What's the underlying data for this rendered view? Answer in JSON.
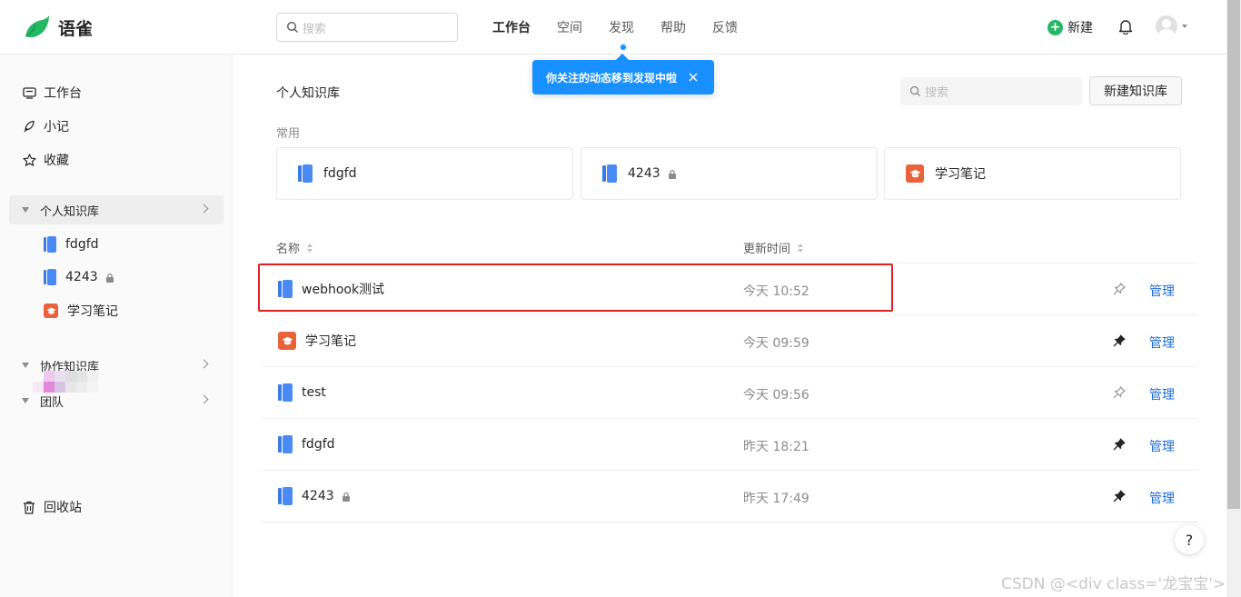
{
  "app": {
    "name": "语雀"
  },
  "header": {
    "search_placeholder": "搜索",
    "nav": [
      "工作台",
      "空间",
      "发现",
      "帮助",
      "反馈"
    ],
    "new_label": "新建"
  },
  "tooltip": {
    "text": "你关注的动态移到发现中啦"
  },
  "sidebar": {
    "workbench": "工作台",
    "notes": "小记",
    "favorites": "收藏",
    "personal_kb": "个人知识库",
    "personal_items": [
      {
        "name": "fdgfd",
        "icon": "book-icon"
      },
      {
        "name": "4243",
        "icon": "book-icon",
        "locked": true
      },
      {
        "name": "学习笔记",
        "icon": "graduation-cap-icon"
      }
    ],
    "collab_kb": "协作知识库",
    "team": "团队",
    "trash": "回收站"
  },
  "main": {
    "title": "个人知识库",
    "search_placeholder": "搜索",
    "new_kb_button": "新建知识库",
    "common_label": "常用",
    "common_cards": [
      {
        "name": "fdgfd",
        "icon": "book-icon"
      },
      {
        "name": "4243",
        "icon": "book-icon",
        "locked": true
      },
      {
        "name": "学习笔记",
        "icon": "graduation-cap-icon"
      }
    ],
    "columns": {
      "name": "名称",
      "updated": "更新时间"
    },
    "rows": [
      {
        "name": "webhook测试",
        "icon": "book-icon",
        "updated": "今天 10:52",
        "pinned": false,
        "manage": "管理"
      },
      {
        "name": "学习笔记",
        "icon": "graduation-cap-icon",
        "updated": "今天 09:59",
        "pinned": true,
        "manage": "管理"
      },
      {
        "name": "test",
        "icon": "book-icon",
        "updated": "今天 09:56",
        "pinned": false,
        "manage": "管理"
      },
      {
        "name": "fdgfd",
        "icon": "book-icon",
        "updated": "昨天 18:21",
        "pinned": true,
        "manage": "管理"
      },
      {
        "name": "4243",
        "icon": "book-icon",
        "locked": true,
        "updated": "昨天 17:49",
        "pinned": true,
        "manage": "管理"
      }
    ]
  },
  "help_label": "?",
  "watermark": "CSDN @<div class='龙宝宝'>",
  "colors": {
    "brand_green": "#25b864",
    "accent_blue": "#1890ff",
    "link_blue": "#1f6dd6",
    "highlight_red": "#e02020",
    "cap_orange": "#e8633a"
  }
}
